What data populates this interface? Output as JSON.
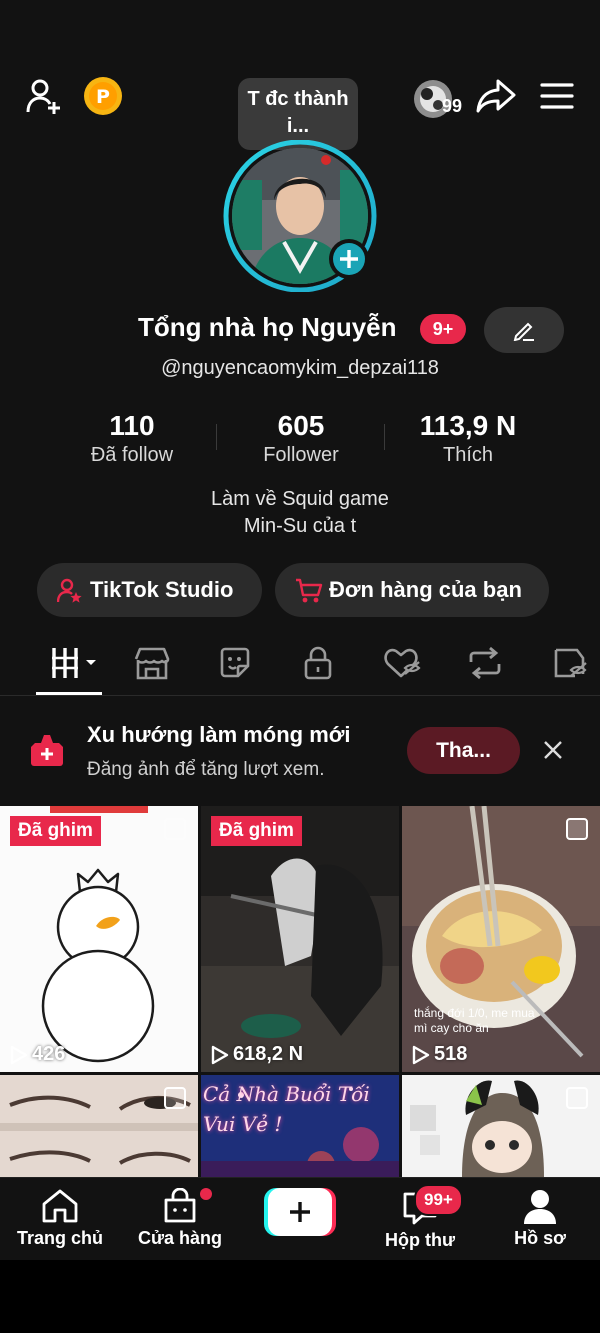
{
  "tooltip": "T đc thành i...",
  "notify_count": "99",
  "profile": {
    "name": "Tổng nhà họ Nguyễn",
    "name_badge": "9+",
    "handle": "@nguyencaomykim_depzai118"
  },
  "stats": [
    {
      "value": "110",
      "label": "Đã follow"
    },
    {
      "value": "605",
      "label": "Follower"
    },
    {
      "value": "113,9 N",
      "label": "Thích"
    }
  ],
  "bio": [
    "Làm về Squid game",
    "Min-Su của t"
  ],
  "buttons": {
    "studio": "TikTok Studio",
    "orders": "Đơn hàng của bạn"
  },
  "promo": {
    "title": "Xu hướng làm móng mới",
    "subtitle": "Đăng ảnh để tăng lượt xem.",
    "button": "Tha..."
  },
  "videos": [
    {
      "pinned": "Đã ghim",
      "views": "426"
    },
    {
      "pinned": "Đã ghim",
      "views": "618,2 N"
    },
    {
      "views": "518",
      "caption": "thắng đới 1/0, me mua mì cay cho ăn"
    },
    {},
    {
      "caption": "Cả Nhà Buổi Tối Vui Vẻ !"
    },
    {}
  ],
  "nav": {
    "home": "Trang chủ",
    "shop": "Cửa hàng",
    "inbox": "Hộp thư",
    "inbox_badge": "99+",
    "profile": "Hồ sơ"
  },
  "colors": {
    "accent": "#e8284b",
    "background": "#121212",
    "ring": "#20c8d8"
  }
}
